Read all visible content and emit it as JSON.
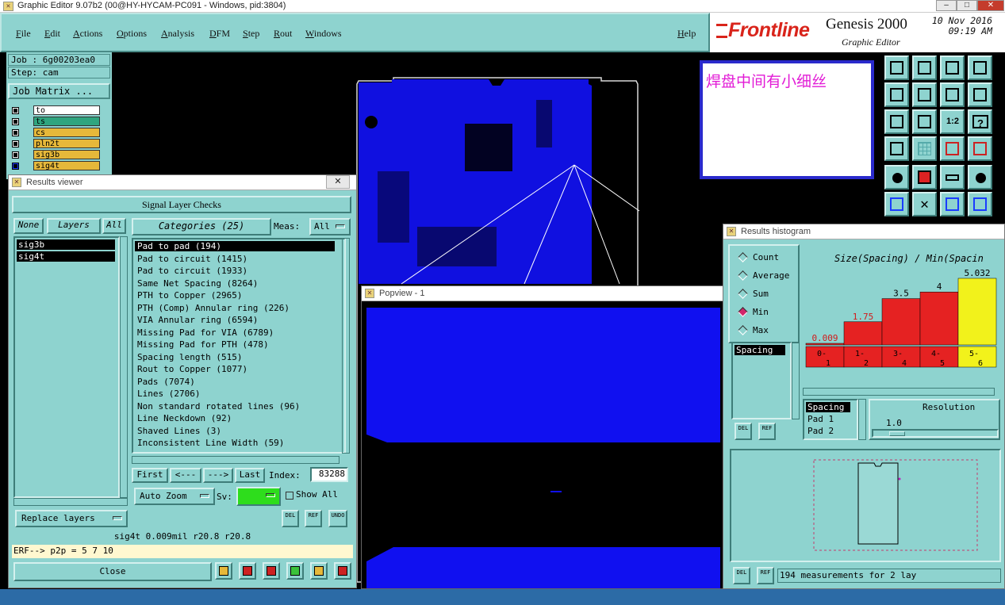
{
  "window": {
    "title": "Graphic Editor 9.07b2 (00@HY-HYCAM-PC091 - Windows, pid:3804)",
    "min_label": "–",
    "max_label": "□",
    "close_label": "✕"
  },
  "menu": {
    "items": [
      "File",
      "Edit",
      "Actions",
      "Options",
      "Analysis",
      "DFM",
      "Step",
      "Rout",
      "Windows"
    ],
    "help": "Help"
  },
  "brand": {
    "logo": "Frontline",
    "product": "Genesis 2000",
    "subtitle": "Graphic Editor",
    "date": "10 Nov 2016",
    "time": "09:19 AM",
    "accent": "#d9241b"
  },
  "job": {
    "job_label": "Job : 6g00203ea0",
    "step_label": "Step: cam",
    "matrix_button": "Job Matrix ...",
    "layers": [
      {
        "name": "to",
        "color": "#ffffff"
      },
      {
        "name": "ts",
        "color": "#2fa57f"
      },
      {
        "name": "cs",
        "color": "#e6b83a"
      },
      {
        "name": "pln2t",
        "color": "#e6b83a"
      },
      {
        "name": "sig3b",
        "color": "#e6b83a"
      },
      {
        "name": "sig4t",
        "color": "#e6b83a"
      }
    ]
  },
  "annotation": {
    "text": "焊盘中间有小细丝"
  },
  "results_viewer": {
    "window_title": "Results viewer",
    "close_x": "✕",
    "header": "Signal Layer Checks",
    "none_label": "None",
    "layers_label": "Layers",
    "all_label": "All",
    "layers": [
      "sig3b",
      "sig4t"
    ],
    "categories_label": "Categories (25)",
    "meas_label": "Meas:",
    "meas_value": "All",
    "categories": [
      "Pad to pad (194)",
      "Pad to circuit (1415)",
      "Pad to circuit (1933)",
      "Same Net Spacing (8264)",
      "PTH to Copper (2965)",
      "PTH (Comp) Annular ring (226)",
      "VIA Annular ring (6594)",
      "Missing Pad for VIA (6789)",
      "Missing Pad for PTH (478)",
      "Spacing length (515)",
      "Rout to Copper (1077)",
      "Pads (7074)",
      "Lines (2706)",
      "Non standard rotated lines (96)",
      "Line Neckdown (92)",
      "Shaved Lines (3)",
      "Inconsistent Line Width (59)"
    ],
    "first": "First",
    "prev": "<---",
    "next": "--->",
    "last": "Last",
    "index_label": "Index:",
    "index_value": "83288",
    "auto_zoom": "Auto Zoom",
    "sv_label": "Sv:",
    "show_all": "Show All",
    "replace_layers": "Replace layers",
    "del": "DEL",
    "ref": "REF",
    "undo": "UNDO",
    "status": "sig4t 0.009mil  r20.8  r20.8",
    "erf": "ERF--> p2p = 5 7 10",
    "close": "Close"
  },
  "popview": {
    "title": "Popview - 1"
  },
  "histogram": {
    "window_title": "Results histogram",
    "modes": [
      "Count",
      "Average",
      "Sum",
      "Min",
      "Max"
    ],
    "selected_mode": "Min",
    "chart_title": "Size(Spacing) / Min(Spacin",
    "measure_list": [
      "Spacing"
    ],
    "res_list": [
      "Spacing",
      "Pad 1",
      "Pad 2"
    ],
    "resolution_label": "Resolution",
    "resolution_value": "1.0",
    "del": "DEL",
    "ref": "REF",
    "status": "194 measurements for 2 lay"
  },
  "chart_data": {
    "type": "bar",
    "categories": [
      "0-1",
      "1-2",
      "3-4",
      "4-5",
      "5-6"
    ],
    "values": [
      0.009,
      1.75,
      3.5,
      4,
      5.032
    ],
    "value_labels": [
      "0.009",
      "1.75",
      "3.5",
      "4",
      "5.032"
    ],
    "colors": [
      "#e52222",
      "#e52222",
      "#e52222",
      "#e52222",
      "#f2f21b"
    ],
    "title": "Size(Spacing) / Min(Spacin",
    "ylim": [
      0,
      5.032
    ]
  }
}
